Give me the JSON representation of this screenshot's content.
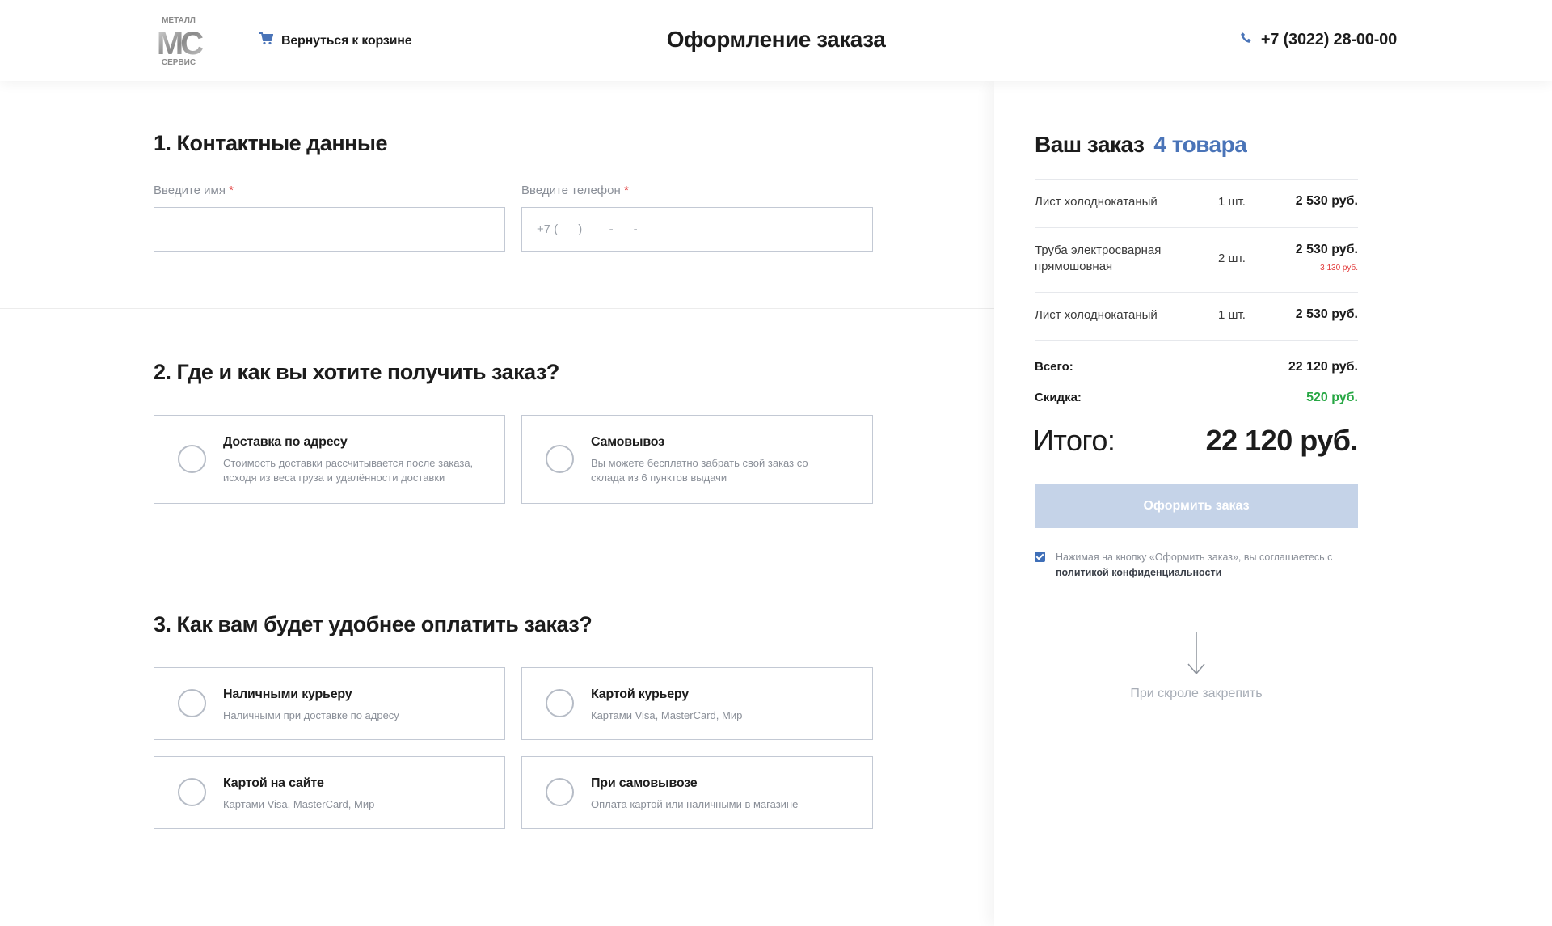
{
  "header": {
    "logo_text": "МЕТАЛЛ СЕРВИС",
    "logo_lines": [
      "МЕТАЛЛ",
      "МС",
      "СЕРВИС"
    ],
    "back_label": "Вернуться к корзине",
    "page_title": "Оформление заказа",
    "phone": "+7 (3022) 28-00-00"
  },
  "contacts": {
    "title": "1. Контактные данные",
    "name_label": "Введите имя",
    "phone_label": "Введите телефон",
    "required_mark": "*",
    "name_value": "",
    "phone_placeholder": "+7 (___) ___ - __ - __"
  },
  "delivery": {
    "title": "2. Где и как вы хотите получить заказ?",
    "options": [
      {
        "title": "Доставка по адресу",
        "desc": "Стоимость доставки рассчитывается после заказа, исходя из веса груза и удалённости доставки"
      },
      {
        "title": "Самовывоз",
        "desc": "Вы можете бесплатно забрать свой заказ со склада из 6 пунктов выдачи"
      }
    ]
  },
  "payment": {
    "title": "3. Как вам будет удобнее оплатить заказ?",
    "options": [
      {
        "title": "Наличными курьеру",
        "desc": "Наличными при доставке по адресу"
      },
      {
        "title": "Картой курьеру",
        "desc": "Картами Visa, MasterCard, Мир"
      },
      {
        "title": "Картой на сайте",
        "desc": "Картами Visa, MasterCard, Мир"
      },
      {
        "title": "При самовывозе",
        "desc": "Оплата картой или наличными в магазине"
      }
    ]
  },
  "order": {
    "title": "Ваш заказ",
    "count": "4 товара",
    "items": [
      {
        "name": "Лист холоднокатаный",
        "qty": "1 шт.",
        "price": "2 530 руб.",
        "old_price": ""
      },
      {
        "name": "Труба электросварная прямошовная",
        "qty": "2 шт.",
        "price": "2 530 руб.",
        "old_price": "3 130 руб."
      },
      {
        "name": "Лист холоднокатаный",
        "qty": "1 шт.",
        "price": "2 530 руб.",
        "old_price": ""
      }
    ],
    "total_label": "Всего:",
    "total_value": "22 120 руб.",
    "discount_label": "Скидка:",
    "discount_value": "520 руб.",
    "grand_label": "Итого:",
    "grand_value": "22 120 руб.",
    "submit_label": "Оформить заказ",
    "agree_text": "Нажимая на кнопку «Оформить заказ», вы соглашаетесь с ",
    "agree_link": "политикой конфиденциальности",
    "agree_checked": true,
    "pin_note": "При скроле закрепить"
  },
  "colors": {
    "accent": "#4a74b8",
    "button_disabled": "#c5d3e8",
    "discount": "#27a744",
    "required": "#e23b3b"
  }
}
